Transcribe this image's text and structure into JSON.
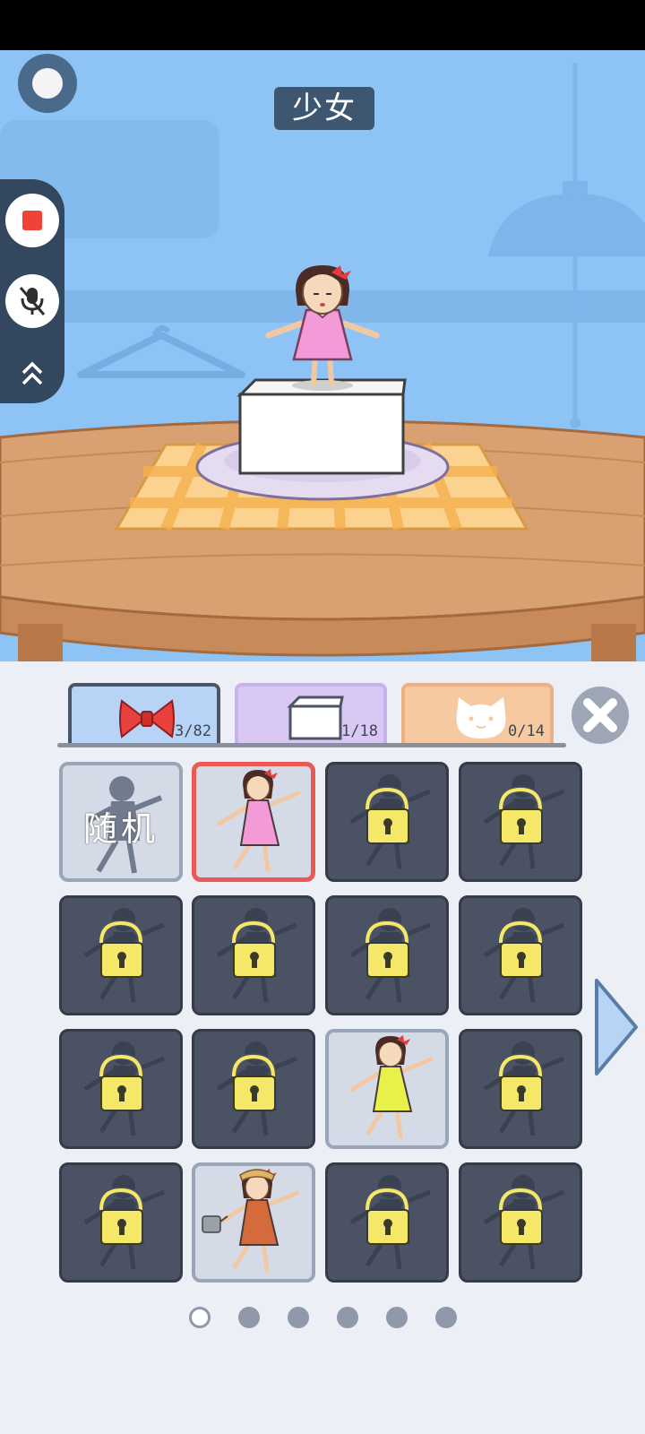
{
  "scene": {
    "title": "少女"
  },
  "recorder": {
    "stop_icon": "stop-icon",
    "mic_icon": "mic-off-icon",
    "collapse_icon": "chevron-up-double-icon"
  },
  "tabs": [
    {
      "icon": "bow-icon",
      "count": "3/82",
      "color": "#b7d4f6"
    },
    {
      "icon": "box-icon",
      "count": "1/18",
      "color": "#d9c8f3"
    },
    {
      "icon": "cat-icon",
      "count": "0/14",
      "color": "#f7c9a1"
    }
  ],
  "grid": {
    "random_label": "随机",
    "cells": [
      {
        "state": "random"
      },
      {
        "state": "unlocked",
        "selected": true,
        "outfit": "pink-dress"
      },
      {
        "state": "locked"
      },
      {
        "state": "locked"
      },
      {
        "state": "locked"
      },
      {
        "state": "locked"
      },
      {
        "state": "locked"
      },
      {
        "state": "locked"
      },
      {
        "state": "locked"
      },
      {
        "state": "locked"
      },
      {
        "state": "unlocked",
        "outfit": "yellow-dress"
      },
      {
        "state": "locked"
      },
      {
        "state": "locked"
      },
      {
        "state": "unlocked",
        "outfit": "apron-with-watering-can"
      },
      {
        "state": "locked"
      },
      {
        "state": "locked"
      }
    ]
  },
  "pagination": {
    "pages": 6,
    "current": 1
  },
  "colors": {
    "sky": "#8ec3f5",
    "badge": "#3e5670",
    "locked_cell": "#4a5263",
    "selected_border": "#ea5a54",
    "lock": "#f5e768"
  }
}
